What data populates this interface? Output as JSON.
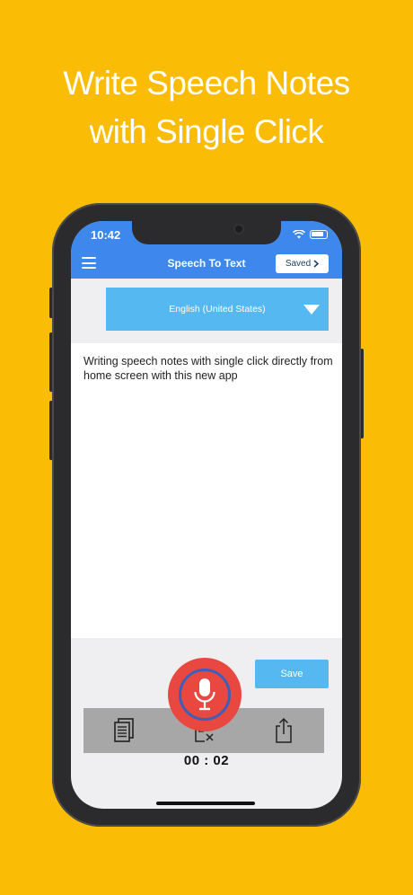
{
  "promo": {
    "line1": "Write Speech Notes",
    "line2": "with Single Click"
  },
  "status_bar": {
    "time": "10:42",
    "icons": [
      "wifi-icon",
      "battery-icon"
    ]
  },
  "header": {
    "menu_icon": "hamburger-menu-icon",
    "title": "Speech To Text",
    "saved_label": "Saved",
    "saved_icon": "chevron-right-icon"
  },
  "language": {
    "selected": "English (United States)",
    "icon": "dropdown-arrow-icon"
  },
  "note": {
    "text": "Writing speech notes with single click directly from home screen with this new app"
  },
  "toolbar": {
    "icons": [
      "copy-icon",
      "clear-text-icon",
      "share-icon"
    ]
  },
  "actions": {
    "save_label": "Save",
    "mic_icon": "microphone-icon"
  },
  "recording": {
    "timer": "00 : 02"
  },
  "colors": {
    "background": "#FBBC05",
    "header": "#3E87EC",
    "accent": "#55B8F1",
    "mic": "#E94840",
    "toolbar": "#A7A7A7"
  }
}
